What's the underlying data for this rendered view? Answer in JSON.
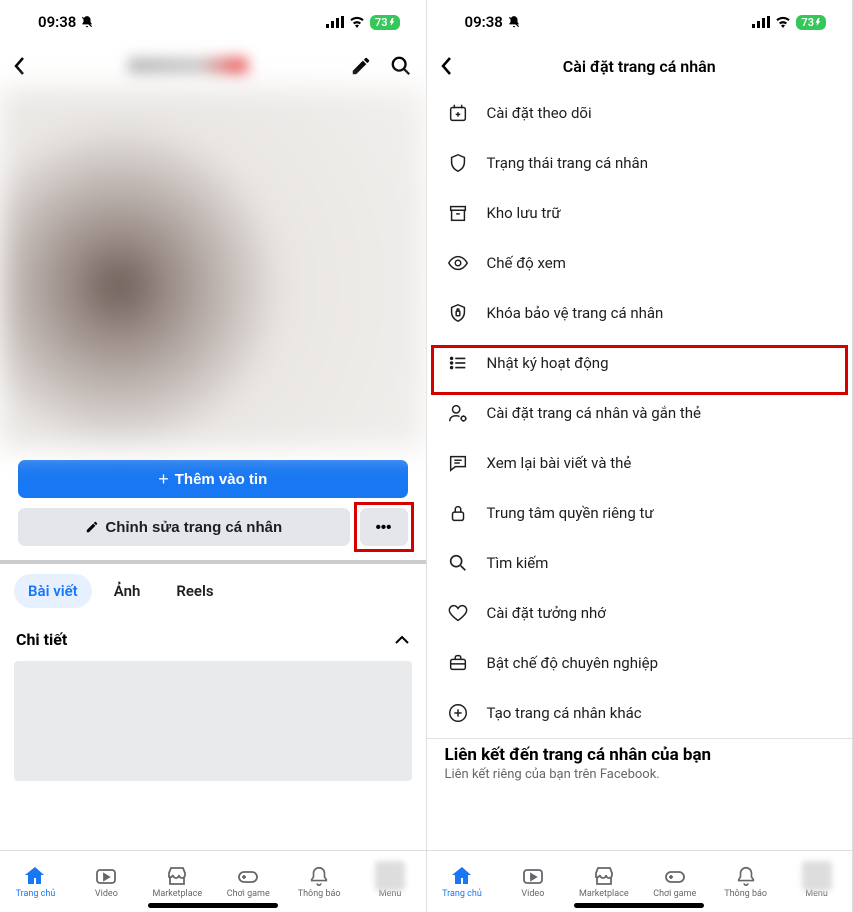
{
  "status": {
    "time": "09:38",
    "battery": "73"
  },
  "left": {
    "add_to_story": "Thêm vào tin",
    "edit_profile": "Chỉnh sửa trang cá nhân",
    "tabs": {
      "posts": "Bài viết",
      "photos": "Ảnh",
      "reels": "Reels"
    },
    "details": "Chi tiết"
  },
  "right": {
    "title": "Cài đặt trang cá nhân",
    "items": [
      "Cài đặt theo dõi",
      "Trạng thái trang cá nhân",
      "Kho lưu trữ",
      "Chế độ xem",
      "Khóa bảo vệ trang cá nhân",
      "Nhật ký hoạt động",
      "Cài đặt trang cá nhân và gắn thẻ",
      "Xem lại bài viết và thẻ",
      "Trung tâm quyền riêng tư",
      "Tìm kiếm",
      "Cài đặt tưởng nhớ",
      "Bật chế độ chuyên nghiệp",
      "Tạo trang cá nhân khác"
    ],
    "link_title": "Liên kết đến trang cá nhân của bạn",
    "link_sub": "Liên kết riêng của bạn trên Facebook."
  },
  "nav": {
    "home": "Trang chủ",
    "video": "Video",
    "marketplace": "Marketplace",
    "gaming": "Chơi game",
    "notifications": "Thông báo",
    "menu": "Menu"
  }
}
